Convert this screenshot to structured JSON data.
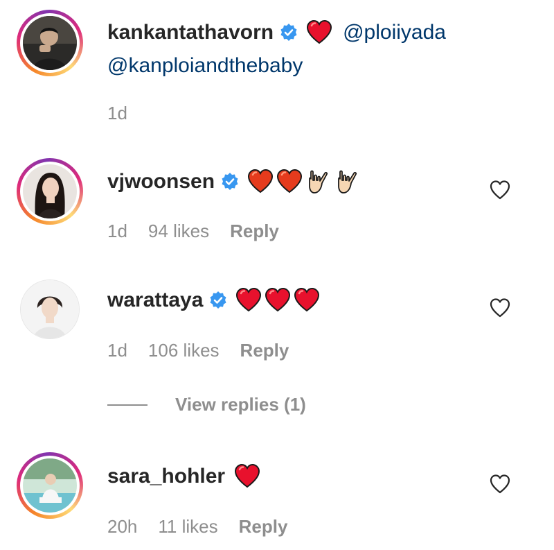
{
  "comments": [
    {
      "username": "kankantathavorn",
      "verified": true,
      "emojis": [
        "red-heart"
      ],
      "mention_1": "@ploiiyada",
      "mention_2": "@kanploiandthebaby",
      "time": "1d",
      "likes": "",
      "reply": ""
    },
    {
      "username": "vjwoonsen",
      "verified": true,
      "emojis": [
        "orange-heart",
        "orange-heart",
        "love-you-gesture",
        "love-you-gesture"
      ],
      "time": "1d",
      "likes": "94 likes",
      "reply": "Reply"
    },
    {
      "username": "warattaya",
      "verified": true,
      "emojis": [
        "red-heart",
        "red-heart",
        "red-heart"
      ],
      "time": "1d",
      "likes": "106 likes",
      "reply": "Reply",
      "view_replies": "View replies (1)"
    },
    {
      "username": "sara_hohler",
      "verified": false,
      "emojis": [
        "red-heart"
      ],
      "time": "20h",
      "likes": "11 likes",
      "reply": "Reply"
    }
  ],
  "colors": {
    "text": "#262626",
    "muted": "#8e8e8e",
    "mention": "#00376b",
    "verified": "#3897f0",
    "heart_red": "#e8112d",
    "heart_orange": "#e53b1d"
  }
}
